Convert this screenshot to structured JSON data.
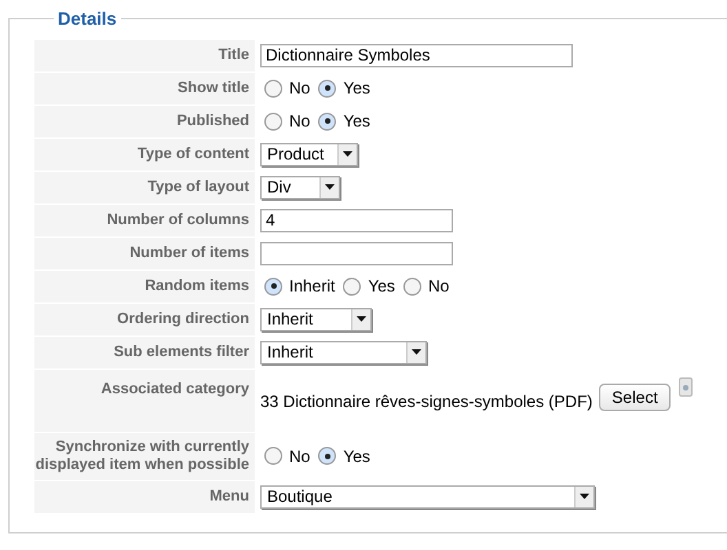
{
  "legend": "Details",
  "fields": [
    {
      "label": "Title",
      "kind": "text",
      "value": "Dictionnaire Symboles"
    },
    {
      "label": "Show title",
      "kind": "radio",
      "options": [
        {
          "label": "No",
          "selected": false
        },
        {
          "label": "Yes",
          "selected": true
        }
      ]
    },
    {
      "label": "Published",
      "kind": "radio",
      "options": [
        {
          "label": "No",
          "selected": false
        },
        {
          "label": "Yes",
          "selected": true
        }
      ]
    },
    {
      "label": "Type of content",
      "kind": "select",
      "value": "Product"
    },
    {
      "label": "Type of layout",
      "kind": "select",
      "value": "Div"
    },
    {
      "label": "Number of columns",
      "kind": "text",
      "value": "4"
    },
    {
      "label": "Number of items",
      "kind": "text"
    },
    {
      "label": "Random items",
      "kind": "radio",
      "options": [
        {
          "label": "Inherit",
          "selected": true
        },
        {
          "label": "Yes",
          "selected": false
        },
        {
          "label": "No",
          "selected": false
        }
      ]
    },
    {
      "label": "Ordering direction",
      "kind": "select",
      "value": "Inherit"
    },
    {
      "label": "Sub elements filter",
      "kind": "select",
      "value": "Inherit"
    },
    {
      "label": "Associated category",
      "kind": "category",
      "value": "33 Dictionnaire rêves-signes-symboles (PDF)",
      "button": "Select"
    },
    {
      "label": "Synchronize with currently displayed item when possible",
      "kind": "radio",
      "options": [
        {
          "label": "No",
          "selected": false
        },
        {
          "label": "Yes",
          "selected": true
        }
      ]
    },
    {
      "label": "Menu",
      "kind": "select",
      "value": "Boutique"
    }
  ]
}
